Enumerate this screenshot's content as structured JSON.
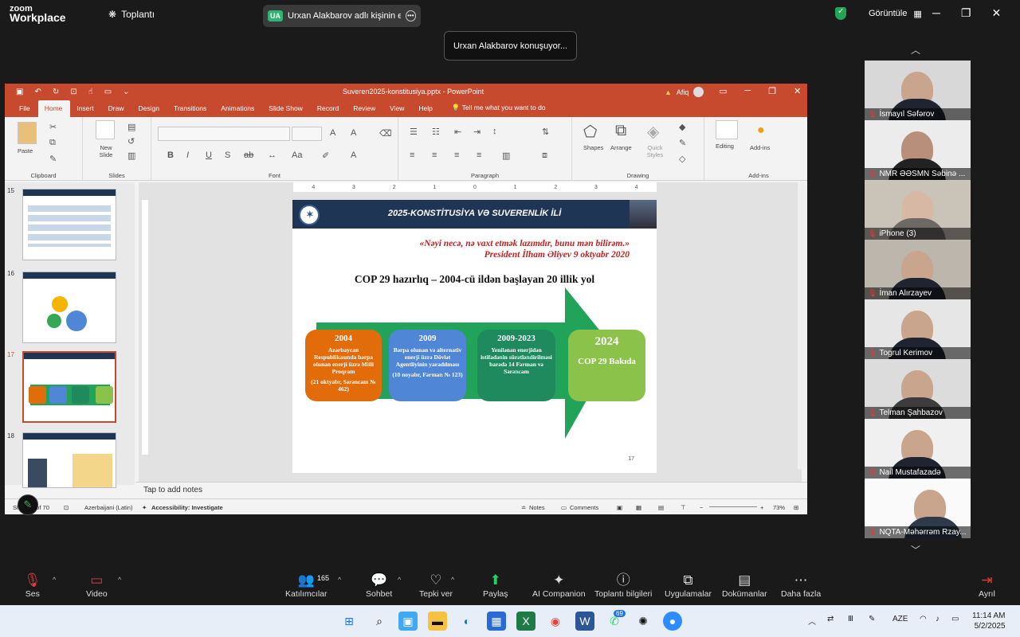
{
  "zoom": {
    "logo_line1": "zoom",
    "logo_line2": "Workplace",
    "meetings_label": "Toplantı",
    "share_badge": "UA",
    "share_label": "Urxan Alakbarov adlı kişinin ekranı",
    "view_label": "Görüntüle",
    "speaking_toast": "Urxan Alakbarov konuşuyor..."
  },
  "ppt": {
    "doc_title": "Suveren2025-konstitusiya.pptx  -  PowerPoint",
    "user_name": "Afiq",
    "menu": [
      "File",
      "Home",
      "Insert",
      "Draw",
      "Design",
      "Transitions",
      "Animations",
      "Slide Show",
      "Record",
      "Review",
      "View",
      "Help"
    ],
    "tell_me": "Tell me what you want to do",
    "ribbon": {
      "paste": "Paste",
      "new_slide": "New Slide",
      "clipboard": "Clipboard",
      "slides": "Slides",
      "font": "Font",
      "paragraph": "Paragraph",
      "shapes": "Shapes",
      "arrange": "Arrange",
      "quick_styles": "Quick Styles",
      "drawing": "Drawing",
      "editing": "Editing",
      "addins": "Add-ins",
      "addins_group": "Add-ins"
    },
    "thumbs": [
      {
        "num": "15",
        "selected": false
      },
      {
        "num": "16",
        "selected": false
      },
      {
        "num": "17",
        "selected": true
      },
      {
        "num": "18",
        "selected": false
      }
    ],
    "ruler": [
      "4",
      "3",
      "2",
      "1",
      "0",
      "1",
      "2",
      "3",
      "4"
    ],
    "notes_placeholder": "Tap to add notes",
    "status": {
      "slide_info": "Slide 17 of 70",
      "language": "Azerbaijani (Latin)",
      "accessibility": "Accessibility: Investigate",
      "notes": "Notes",
      "comments": "Comments",
      "zoom": "73%"
    }
  },
  "slide": {
    "header": "2025-KONSTİTUSİYA VƏ SUVERENLİK İLİ",
    "quote_line1": "«Nəyi necə, nə vaxt etmək lazımdır, bunu mən bilirəm.»",
    "quote_line2": "President İlham Əliyev 9 oktyabr 2020",
    "title": "COP 29 hazırlıq – 2004-cü ildən başlayan 20 illik yol",
    "boxes": [
      {
        "year": "2004",
        "text": "Azərbaycan Respublikasında bərpa olunan enerji üzrə Milli Proqram",
        "note": "(21 oktyabr, Sərəncam № 462)",
        "color": "#e36c0a"
      },
      {
        "year": "2009",
        "text": "Bərpa olunan və alternativ enerji üzrə Dövlət Agentliyinin yaradılması",
        "note": "(10 noyabr, Fərman № 123)",
        "color": "#4f86d6"
      },
      {
        "year": "2009-2023",
        "text": "Yenilənən enerjidən istifadənin sürətləndirilməsi barədə 14 Fərman və Sərəncam",
        "note": "",
        "color": "#1e8a5e"
      },
      {
        "year": "2024",
        "text": "COP 29 Bakıda",
        "note": "",
        "color": "#8bc34a"
      }
    ],
    "page_number": "17"
  },
  "participants": [
    {
      "name": "İsmayıl Səfərov"
    },
    {
      "name": "NMR ƏƏSMN Səbinə ..."
    },
    {
      "name": "iPhone (3)"
    },
    {
      "name": "İman Alırzayev"
    },
    {
      "name": "Togrul Kerimov"
    },
    {
      "name": "Telman Şahbazov"
    },
    {
      "name": "Nail Mustafazadə"
    },
    {
      "name": "NQTA-Məhərrəm Rzay..."
    }
  ],
  "toolbar": {
    "audio": "Ses",
    "video": "Video",
    "participants": "Katılımcılar",
    "participants_count": "165",
    "chat": "Sohbet",
    "react": "Tepki ver",
    "share": "Paylaş",
    "ai": "AI Companion",
    "info": "Toplantı bilgileri",
    "apps": "Uygulamalar",
    "docs": "Dokümanlar",
    "more": "Daha fazla",
    "leave": "Ayrıl"
  },
  "taskbar": {
    "whatsapp_badge": "69",
    "lang": "AZE",
    "time": "11:14 AM",
    "date": "5/2/2025"
  },
  "colors": {
    "ppt_accent": "#c74a2f",
    "slide_header": "#1f3556",
    "quote_red": "#c0211f",
    "arrow_green": "#21a35a"
  }
}
